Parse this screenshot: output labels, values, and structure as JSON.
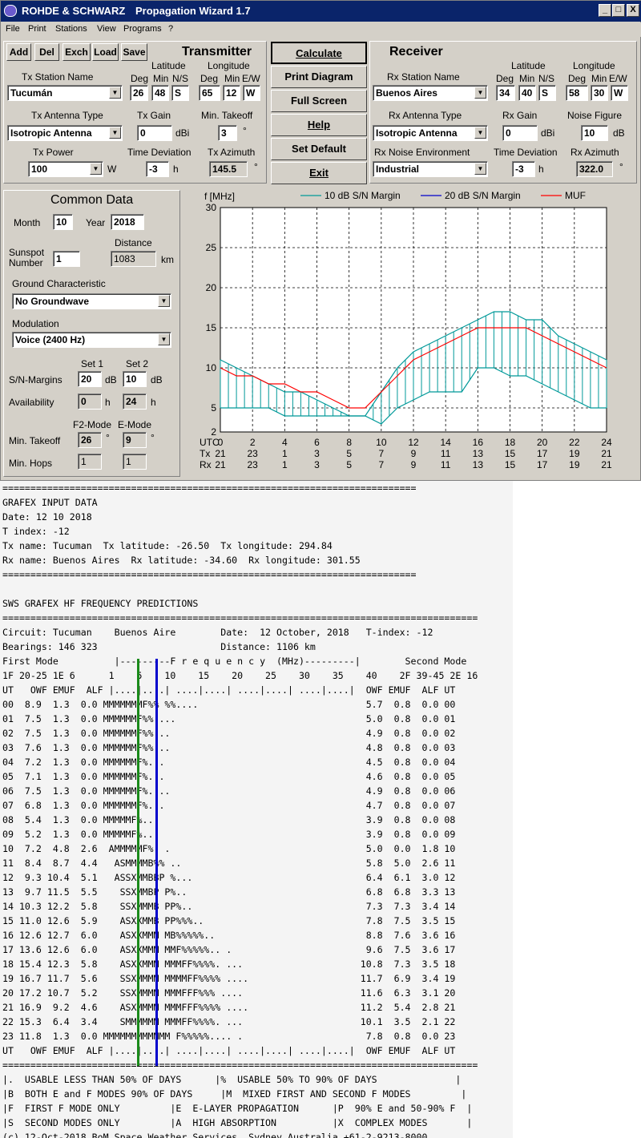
{
  "window": {
    "brand": "ROHDE & SCHWARZ",
    "title": "Propagation Wizard  1.7",
    "min": "_",
    "max": "□",
    "close": "X"
  },
  "menu": [
    "File",
    "Print",
    "Stations",
    "View",
    "Programs",
    "?"
  ],
  "transmitter": {
    "heading": "Transmitter",
    "buttons": [
      "Add",
      "Del",
      "Exch",
      "Load",
      "Save"
    ],
    "lat_label": "Latitude",
    "lon_label": "Longitude",
    "deg": "Deg",
    "min": "Min",
    "ns": "N/S",
    "ew": "E/W",
    "station_label": "Tx Station Name",
    "station": "Tucumán",
    "lat_deg": "26",
    "lat_min": "48",
    "lat_ns": "S",
    "lon_deg": "65",
    "lon_min": "12",
    "lon_ew": "W",
    "antenna_label": "Tx Antenna Type",
    "antenna": "Isotropic Antenna",
    "gain_label": "Tx Gain",
    "gain": "0",
    "gain_unit": "dBi",
    "takeoff_label": "Min. Takeoff",
    "takeoff": "3",
    "deg_sym": "°",
    "power_label": "Tx Power",
    "power": "100",
    "power_unit": "W",
    "td_label": "Time Deviation",
    "td": "-3",
    "td_unit": "h",
    "az_label": "Tx Azimuth",
    "az": "145.5"
  },
  "actions": [
    "Calculate",
    "Print Diagram",
    "Full Screen",
    "Help",
    "Set Default",
    "Exit"
  ],
  "receiver": {
    "heading": "Receiver",
    "lat_label": "Latitude",
    "lon_label": "Longitude",
    "deg": "Deg",
    "min": "Min",
    "ns": "N/S",
    "ew": "E/W",
    "station_label": "Rx Station Name",
    "station": "Buenos Aires",
    "lat_deg": "34",
    "lat_min": "40",
    "lat_ns": "S",
    "lon_deg": "58",
    "lon_min": "30",
    "lon_ew": "W",
    "antenna_label": "Rx Antenna Type",
    "antenna": "Isotropic Antenna",
    "gain_label": "Rx Gain",
    "gain": "0",
    "gain_unit": "dBi",
    "nf_label": "Noise Figure",
    "nf": "10",
    "nf_unit": "dB",
    "env_label": "Rx Noise Environment",
    "env": "Industrial",
    "td_label": "Time Deviation",
    "td": "-3",
    "td_unit": "h",
    "az_label": "Rx Azimuth",
    "az": "322.0",
    "deg_sym": "°"
  },
  "common": {
    "heading": "Common Data",
    "month_label": "Month",
    "month": "10",
    "year_label": "Year",
    "year": "2018",
    "ssn_label1": "Sunspot",
    "ssn_label2": "Number",
    "ssn": "1",
    "dist_label": "Distance",
    "dist": "1083",
    "dist_unit": "km",
    "ground_label": "Ground Characteristic",
    "ground": "No Groundwave",
    "mod_label": "Modulation",
    "mod": "Voice   (2400 Hz)",
    "set1": "Set 1",
    "set2": "Set 2",
    "snm_label": "S/N-Margins",
    "snm1": "20",
    "snm2": "10",
    "db": "dB",
    "avail_label": "Availability",
    "avail1": "0",
    "avail2": "24",
    "h": "h",
    "f2_label": "F2-Mode",
    "e_label": "E-Mode",
    "mt_label": "Min. Takeoff",
    "mt1": "26",
    "mt2": "9",
    "deg_sym": "°",
    "mh_label": "Min. Hops",
    "mh1": "1",
    "mh2": "1"
  },
  "chart_data": {
    "type": "line",
    "ylabel": "f [MHz]",
    "legend": [
      {
        "name": "10 dB S/N Margin",
        "color": "#009999"
      },
      {
        "name": "20 dB S/N Margin",
        "color": "#0000cc"
      },
      {
        "name": "MUF",
        "color": "#ff0000"
      }
    ],
    "ylim": [
      2,
      30
    ],
    "yticks": [
      2,
      5,
      10,
      15,
      20,
      25,
      30
    ],
    "xlim": [
      0,
      24
    ],
    "xrows": [
      {
        "label": "UTC",
        "values": [
          "0",
          "2",
          "4",
          "6",
          "8",
          "10",
          "12",
          "14",
          "16",
          "18",
          "20",
          "22",
          "24"
        ]
      },
      {
        "label": "Tx",
        "values": [
          "21",
          "23",
          "1",
          "3",
          "5",
          "7",
          "9",
          "11",
          "13",
          "15",
          "17",
          "19",
          "21"
        ]
      },
      {
        "label": "Rx",
        "values": [
          "21",
          "23",
          "1",
          "3",
          "5",
          "7",
          "9",
          "11",
          "13",
          "15",
          "17",
          "19",
          "21"
        ]
      }
    ],
    "x": [
      0,
      1,
      2,
      3,
      4,
      5,
      6,
      7,
      8,
      9,
      10,
      11,
      12,
      13,
      14,
      15,
      16,
      17,
      18,
      19,
      20,
      21,
      22,
      23,
      24
    ],
    "muf": [
      10,
      9,
      9,
      8,
      8,
      7,
      7,
      6,
      5,
      5,
      7,
      9,
      11,
      12,
      13,
      14,
      15,
      15,
      15,
      15,
      14,
      13,
      12,
      11,
      10
    ],
    "snr10_upper": [
      11,
      10,
      9,
      8,
      7,
      7,
      6,
      5,
      4,
      4,
      7,
      10,
      12,
      13,
      14,
      15,
      16,
      17,
      17,
      16,
      16,
      14,
      13,
      12,
      11
    ],
    "snr10_lower": [
      5,
      5,
      5,
      5,
      4,
      4,
      4,
      4,
      4,
      4,
      3,
      5,
      6,
      7,
      7,
      7,
      10,
      10,
      9,
      9,
      8,
      7,
      6,
      5,
      5
    ],
    "grid": true,
    "legend_position": "top"
  },
  "report": {
    "lines": [
      "==========================================================================",
      "GRAFEX INPUT DATA",
      "Date: 12 10 2018",
      "T index: -12",
      "Tx name: Tucuman  Tx latitude: -26.50  Tx longitude: 294.84",
      "Rx name: Buenos Aires  Rx latitude: -34.60  Rx longitude: 301.55",
      "==========================================================================",
      "",
      "SWS GRAFEX HF FREQUENCY PREDICTIONS",
      "=====================================================================================",
      "Circuit: Tucuman    Buenos Aire        Date:  12 October, 2018   T-index: -12",
      "Bearings: 146 323                      Distance: 1106 km",
      "First Mode          |---------F r e q u e n c y  (MHz)---------|        Second Mode",
      "1F 20-25 1E 6      1    5    10    15    20    25    30    35    40    2F 39-45 2E 16",
      "UT   OWF EMUF  ALF |....|....| ....|....| ....|....| ....|....|  OWF EMUF  ALF UT",
      "00  8.9  1.3  0.0 MMMMMMMF%% %%....                              5.7  0.8  0.0 00",
      "01  7.5  1.3  0.0 MMMMMMF%% ...                                  5.0  0.8  0.0 01",
      "02  7.5  1.3  0.0 MMMMMMF%% ..                                   4.9  0.8  0.0 02",
      "03  7.6  1.3  0.0 MMMMMMF%% ..                                   4.8  0.8  0.0 03",
      "04  7.2  1.3  0.0 MMMMMMF%. .                                    4.5  0.8  0.0 04",
      "05  7.1  1.3  0.0 MMMMMMF%. .                                    4.6  0.8  0.0 05",
      "06  7.5  1.3  0.0 MMMMMMF%. ..                                   4.9  0.8  0.0 06",
      "07  6.8  1.3  0.0 MMMMMMF%. .                                    4.7  0.8  0.0 07",
      "08  5.4  1.3  0.0 MMMMMF%..                                      3.9  0.8  0.0 08",
      "09  5.2  1.3  0.0 MMMMMF%..                                      3.9  0.8  0.0 09",
      "10  7.2  4.8  2.6  AMMMMMF%. .                                   5.0  0.0  1.8 10",
      "11  8.4  8.7  4.4   ASMMMMB%% ..                                 5.8  5.0  2.6 11",
      "12  9.3 10.4  5.1   ASSXMMBBP %...                               6.4  6.1  3.0 12",
      "13  9.7 11.5  5.5    SSXMMBP P%..                                6.8  6.8  3.3 13",
      "14 10.3 12.2  5.8    SSXMMMB PP%..                               7.3  7.3  3.4 14",
      "15 11.0 12.6  5.9    ASXXMMB PP%%%..                             7.8  7.5  3.5 15",
      "16 12.6 12.7  6.0    ASXXMMM MB%%%%%..                           8.8  7.6  3.6 16",
      "17 13.6 12.6  6.0    ASXXMMM MMF%%%%%.. .                        9.6  7.5  3.6 17",
      "18 15.4 12.3  5.8    ASXXMMM MMMFF%%%%. ...                     10.8  7.3  3.5 18",
      "19 16.7 11.7  5.6    SSXMMMM MMMMFF%%%% ....                    11.7  6.9  3.4 19",
      "20 17.2 10.7  5.2    SSXMMMM MMMFFF%%% ....                     11.6  6.3  3.1 20",
      "21 16.9  9.2  4.6    ASXMMMM MMMFFF%%%% ....                    11.2  5.4  2.8 21",
      "22 15.3  6.4  3.4    SMMMMMM MMMFF%%%%. ...                     10.1  3.5  2.1 22",
      "23 11.8  1.3  0.0 MMMMMMMMMMMM F%%%%%.... .                      7.8  0.8  0.0 23",
      "UT   OWF EMUF  ALF |....|....| ....|....| ....|....| ....|....|  OWF EMUF  ALF UT",
      "=====================================================================================",
      "|.  USABLE LESS THAN 50% OF DAYS      |%  USABLE 50% TO 90% OF DAYS              |",
      "|B  BOTH E and F MODES 90% OF DAYS     |M  MIXED FIRST AND SECOND F MODES         |",
      "|F  FIRST F MODE ONLY         |E  E-LAYER PROPAGATION      |P  90% E and 50-90% F  |",
      "|S  SECOND MODES ONLY         |A  HIGH ABSORPTION          |X  COMPLEX MODES       |",
      "(c) 12-Oct-2018 BoM Space Weather Services, Sydney Australia +61-2-9213-8000"
    ]
  },
  "colors": {
    "titlebar": "#0a246a",
    "face": "#d4d0c8",
    "margin10": "#009999",
    "margin20": "#0000cc",
    "muf": "#ff0000",
    "marker_green": "#1a8a1a",
    "marker_blue": "#0000cc"
  }
}
